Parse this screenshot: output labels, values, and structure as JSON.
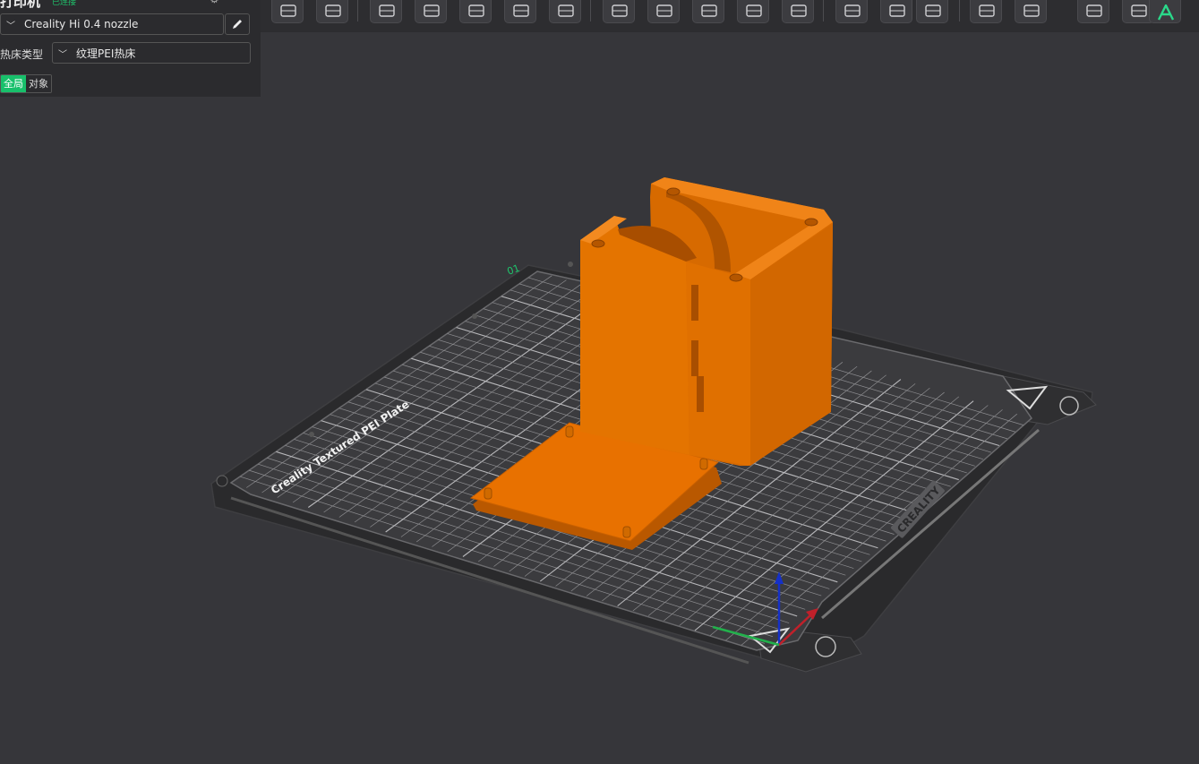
{
  "left_panel": {
    "header_title": "打印机",
    "header_sub": "已连接",
    "printer_preset": "Creality Hi 0.4 nozzle",
    "bed_type_label": "热床类型",
    "bed_type_value": "纹理PEI热床",
    "scope_tabs": [
      "全局",
      "对象"
    ]
  },
  "toolbar": {
    "icons": [
      "add-object-icon",
      "add-plate-icon",
      "auto-orient-icon",
      "lay-on-face-icon",
      "paint-icon",
      "arrange-icon",
      "erase-icon",
      "split-objects-icon",
      "split-parts-icon",
      "scale-icon",
      "slice-box-icon",
      "hollow-icon",
      "support-paint-icon",
      "boolean-icon",
      "measure-icon",
      "assembly-icon",
      "text-icon",
      "layers-icon",
      "color-paint-icon",
      "emboss-text-icon"
    ]
  },
  "plate": {
    "plate_number": "01",
    "plate_title": "Creality Textured PEI Plate",
    "brand": "CREALITY",
    "model_color": "#e87100",
    "axis_colors": {
      "x": "#c0202a",
      "y": "#22b14c",
      "z": "#1530c8"
    }
  }
}
